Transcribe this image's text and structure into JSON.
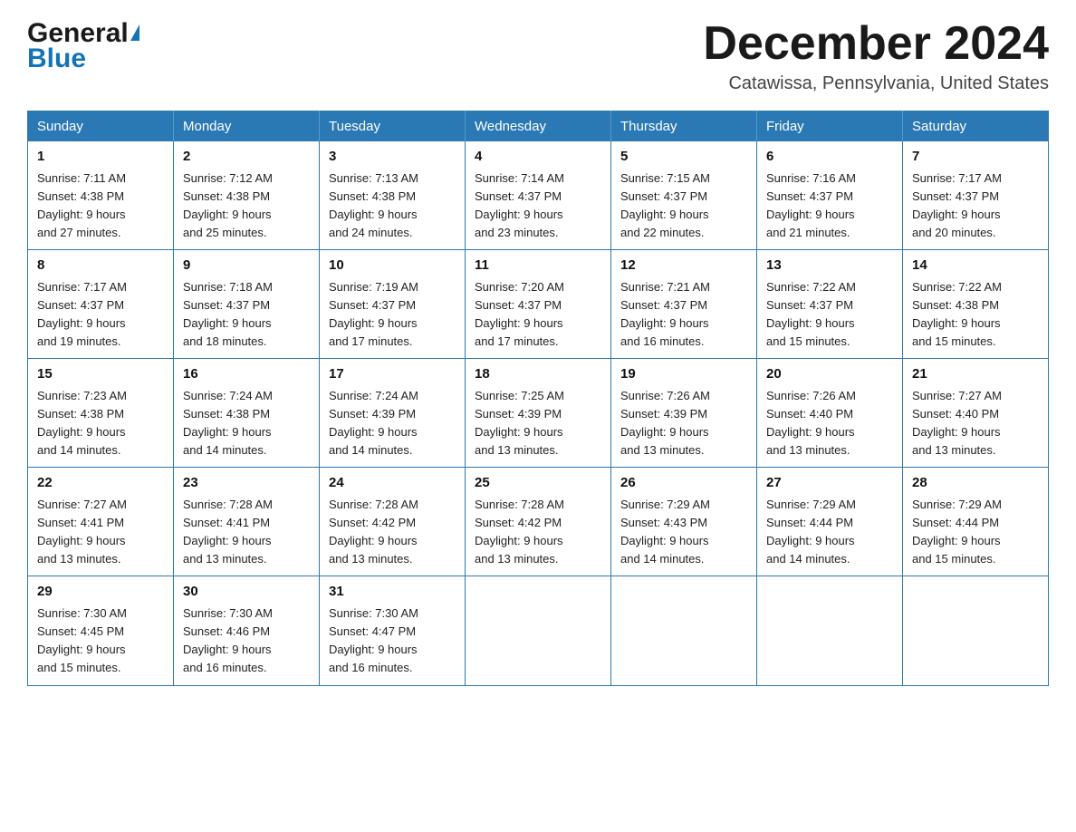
{
  "logo": {
    "general": "General",
    "blue": "Blue"
  },
  "title": "December 2024",
  "subtitle": "Catawissa, Pennsylvania, United States",
  "weekdays": [
    "Sunday",
    "Monday",
    "Tuesday",
    "Wednesday",
    "Thursday",
    "Friday",
    "Saturday"
  ],
  "weeks": [
    [
      {
        "day": "1",
        "sunrise": "7:11 AM",
        "sunset": "4:38 PM",
        "daylight": "9 hours and 27 minutes."
      },
      {
        "day": "2",
        "sunrise": "7:12 AM",
        "sunset": "4:38 PM",
        "daylight": "9 hours and 25 minutes."
      },
      {
        "day": "3",
        "sunrise": "7:13 AM",
        "sunset": "4:38 PM",
        "daylight": "9 hours and 24 minutes."
      },
      {
        "day": "4",
        "sunrise": "7:14 AM",
        "sunset": "4:37 PM",
        "daylight": "9 hours and 23 minutes."
      },
      {
        "day": "5",
        "sunrise": "7:15 AM",
        "sunset": "4:37 PM",
        "daylight": "9 hours and 22 minutes."
      },
      {
        "day": "6",
        "sunrise": "7:16 AM",
        "sunset": "4:37 PM",
        "daylight": "9 hours and 21 minutes."
      },
      {
        "day": "7",
        "sunrise": "7:17 AM",
        "sunset": "4:37 PM",
        "daylight": "9 hours and 20 minutes."
      }
    ],
    [
      {
        "day": "8",
        "sunrise": "7:17 AM",
        "sunset": "4:37 PM",
        "daylight": "9 hours and 19 minutes."
      },
      {
        "day": "9",
        "sunrise": "7:18 AM",
        "sunset": "4:37 PM",
        "daylight": "9 hours and 18 minutes."
      },
      {
        "day": "10",
        "sunrise": "7:19 AM",
        "sunset": "4:37 PM",
        "daylight": "9 hours and 17 minutes."
      },
      {
        "day": "11",
        "sunrise": "7:20 AM",
        "sunset": "4:37 PM",
        "daylight": "9 hours and 17 minutes."
      },
      {
        "day": "12",
        "sunrise": "7:21 AM",
        "sunset": "4:37 PM",
        "daylight": "9 hours and 16 minutes."
      },
      {
        "day": "13",
        "sunrise": "7:22 AM",
        "sunset": "4:37 PM",
        "daylight": "9 hours and 15 minutes."
      },
      {
        "day": "14",
        "sunrise": "7:22 AM",
        "sunset": "4:38 PM",
        "daylight": "9 hours and 15 minutes."
      }
    ],
    [
      {
        "day": "15",
        "sunrise": "7:23 AM",
        "sunset": "4:38 PM",
        "daylight": "9 hours and 14 minutes."
      },
      {
        "day": "16",
        "sunrise": "7:24 AM",
        "sunset": "4:38 PM",
        "daylight": "9 hours and 14 minutes."
      },
      {
        "day": "17",
        "sunrise": "7:24 AM",
        "sunset": "4:39 PM",
        "daylight": "9 hours and 14 minutes."
      },
      {
        "day": "18",
        "sunrise": "7:25 AM",
        "sunset": "4:39 PM",
        "daylight": "9 hours and 13 minutes."
      },
      {
        "day": "19",
        "sunrise": "7:26 AM",
        "sunset": "4:39 PM",
        "daylight": "9 hours and 13 minutes."
      },
      {
        "day": "20",
        "sunrise": "7:26 AM",
        "sunset": "4:40 PM",
        "daylight": "9 hours and 13 minutes."
      },
      {
        "day": "21",
        "sunrise": "7:27 AM",
        "sunset": "4:40 PM",
        "daylight": "9 hours and 13 minutes."
      }
    ],
    [
      {
        "day": "22",
        "sunrise": "7:27 AM",
        "sunset": "4:41 PM",
        "daylight": "9 hours and 13 minutes."
      },
      {
        "day": "23",
        "sunrise": "7:28 AM",
        "sunset": "4:41 PM",
        "daylight": "9 hours and 13 minutes."
      },
      {
        "day": "24",
        "sunrise": "7:28 AM",
        "sunset": "4:42 PM",
        "daylight": "9 hours and 13 minutes."
      },
      {
        "day": "25",
        "sunrise": "7:28 AM",
        "sunset": "4:42 PM",
        "daylight": "9 hours and 13 minutes."
      },
      {
        "day": "26",
        "sunrise": "7:29 AM",
        "sunset": "4:43 PM",
        "daylight": "9 hours and 14 minutes."
      },
      {
        "day": "27",
        "sunrise": "7:29 AM",
        "sunset": "4:44 PM",
        "daylight": "9 hours and 14 minutes."
      },
      {
        "day": "28",
        "sunrise": "7:29 AM",
        "sunset": "4:44 PM",
        "daylight": "9 hours and 15 minutes."
      }
    ],
    [
      {
        "day": "29",
        "sunrise": "7:30 AM",
        "sunset": "4:45 PM",
        "daylight": "9 hours and 15 minutes."
      },
      {
        "day": "30",
        "sunrise": "7:30 AM",
        "sunset": "4:46 PM",
        "daylight": "9 hours and 16 minutes."
      },
      {
        "day": "31",
        "sunrise": "7:30 AM",
        "sunset": "4:47 PM",
        "daylight": "9 hours and 16 minutes."
      },
      null,
      null,
      null,
      null
    ]
  ],
  "labels": {
    "sunrise": "Sunrise:",
    "sunset": "Sunset:",
    "daylight": "Daylight:"
  }
}
